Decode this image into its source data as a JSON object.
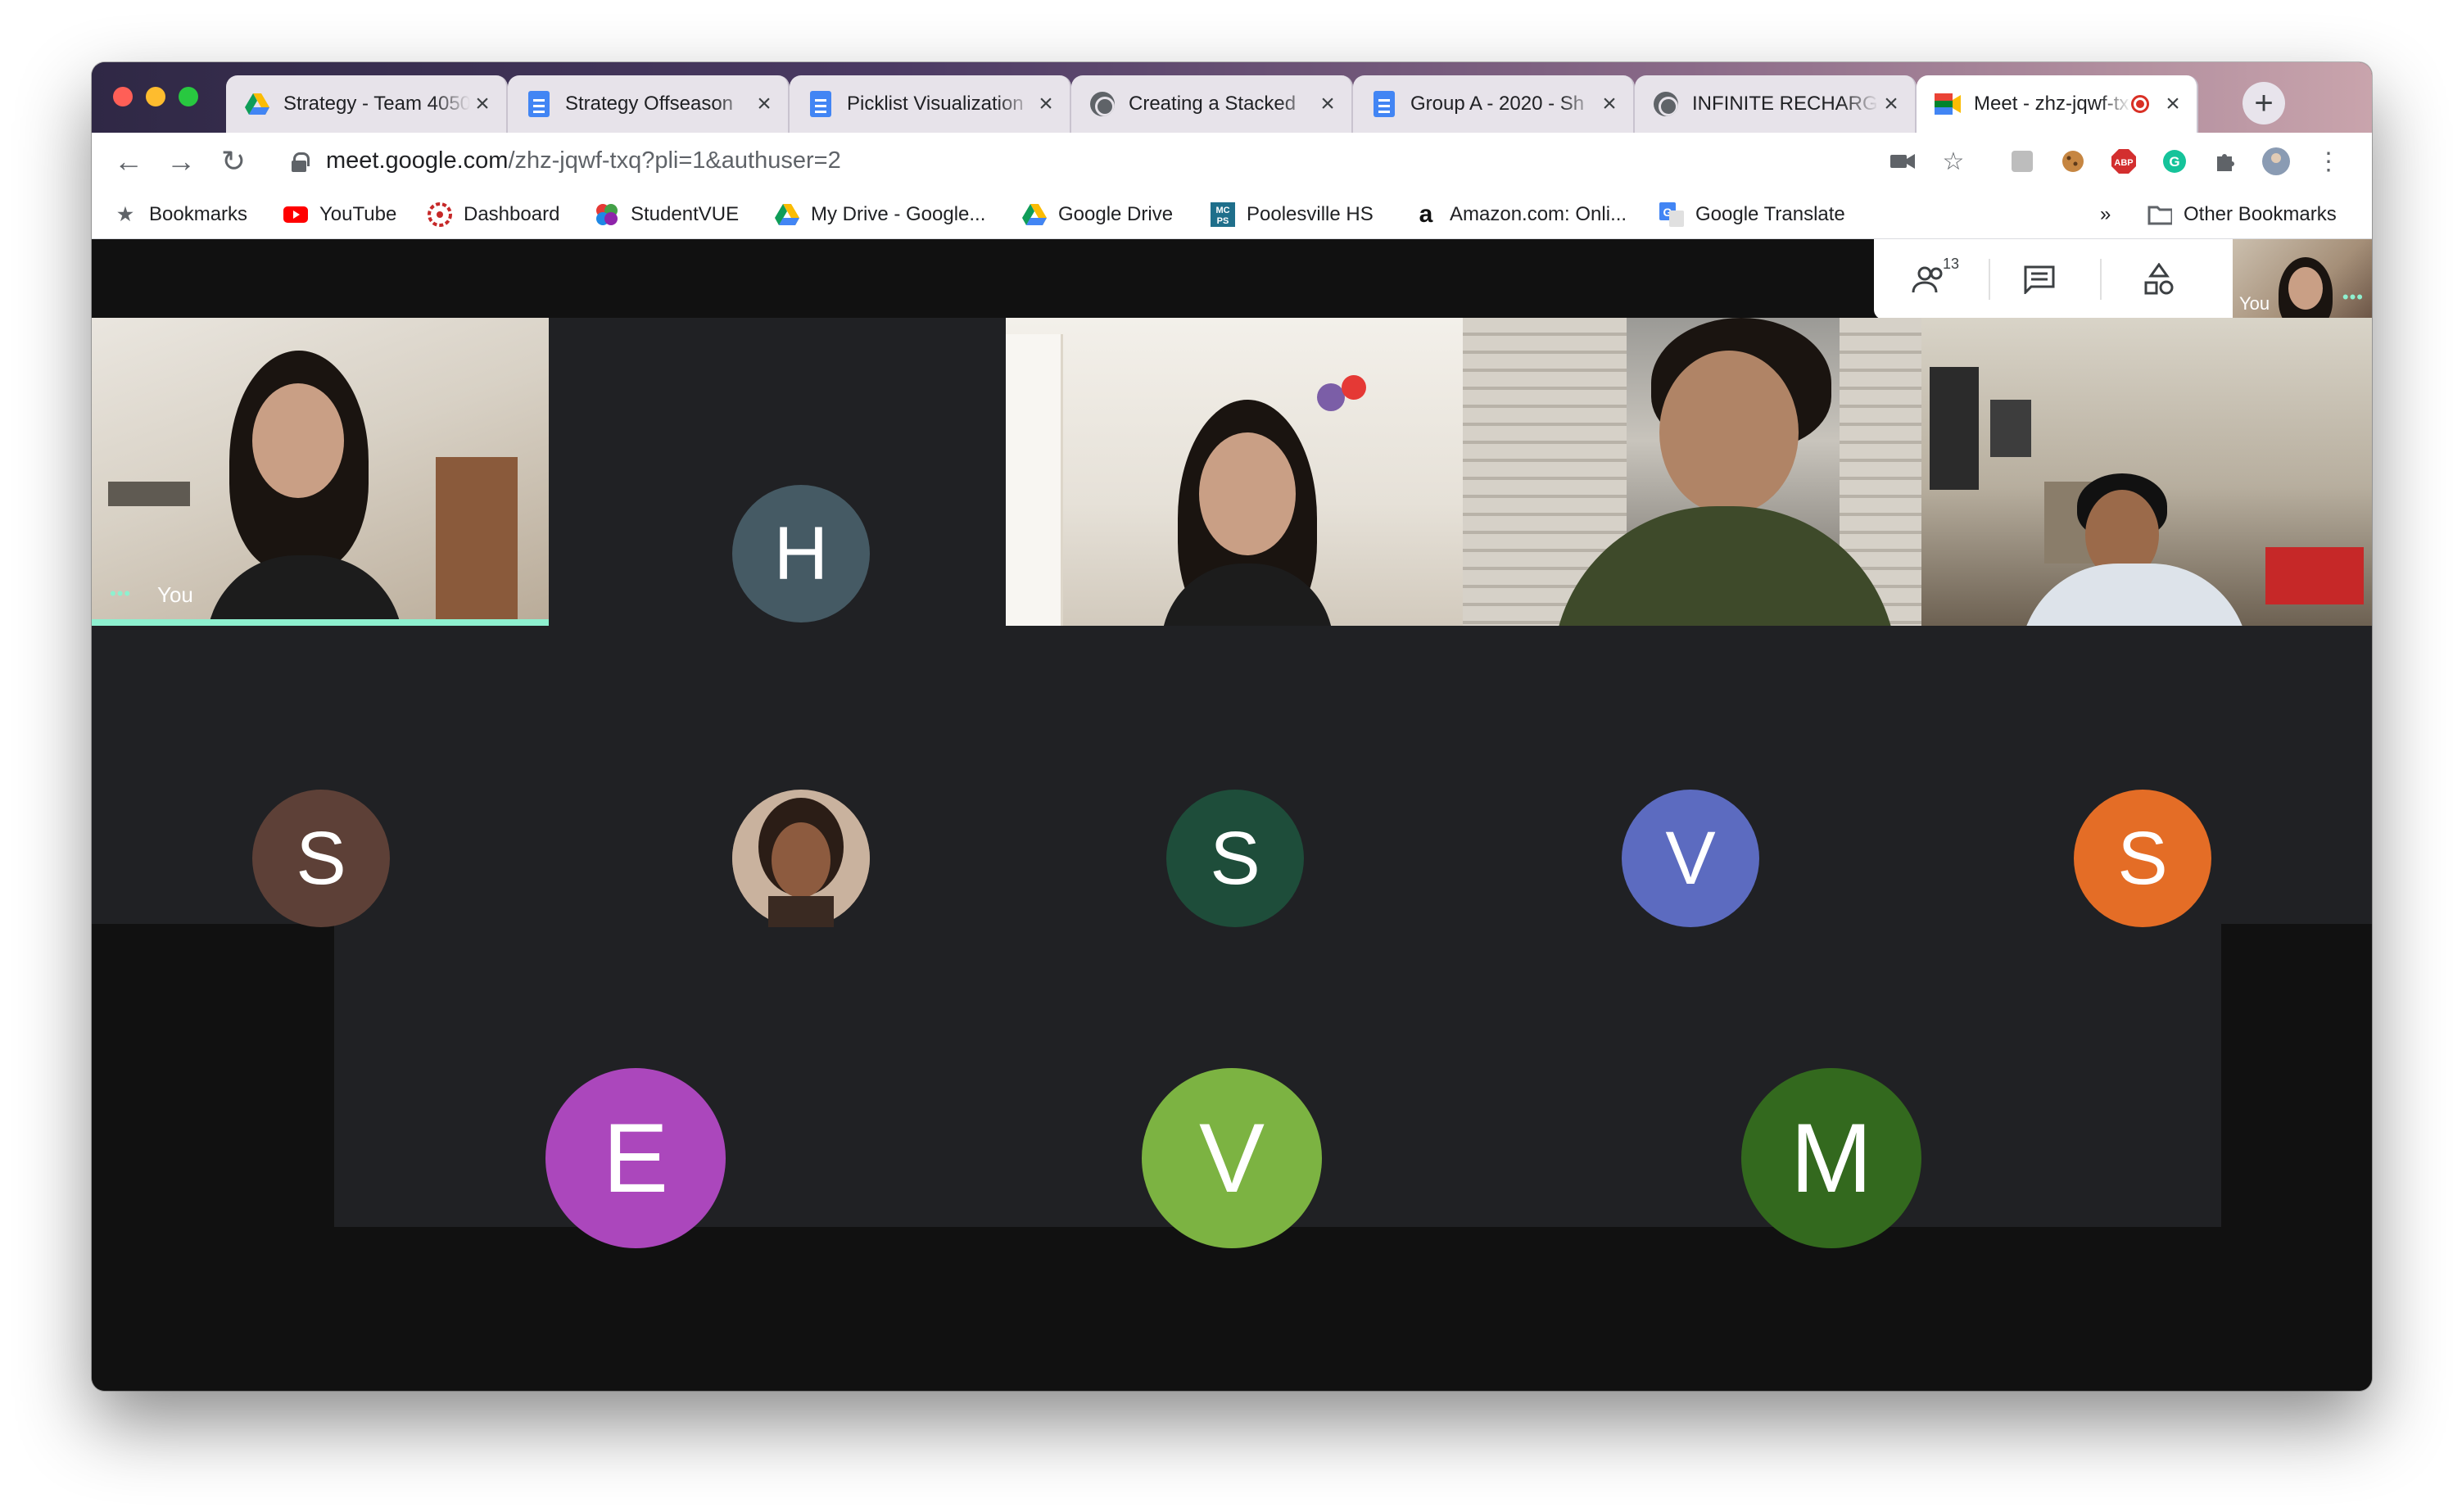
{
  "tabs": [
    {
      "title": "Strategy - Team 4050",
      "icon": "google-drive-icon",
      "active": false
    },
    {
      "title": "Strategy Offseason",
      "icon": "google-docs-icon",
      "active": false
    },
    {
      "title": "Picklist Visualization",
      "icon": "google-docs-icon",
      "active": false
    },
    {
      "title": "Creating a Stacked",
      "icon": "globe-icon",
      "active": false
    },
    {
      "title": "Group A - 2020 - Sh",
      "icon": "google-docs-icon",
      "active": false
    },
    {
      "title": "INFINITE RECHARGE",
      "icon": "globe-icon",
      "active": false
    },
    {
      "title": "Meet - zhz-jqwf-txq",
      "icon": "google-meet-icon",
      "active": true,
      "recording": true
    }
  ],
  "address_bar": {
    "domain": "meet.google.com",
    "path": "/zhz-jqwf-txq?pli=1&authuser=2"
  },
  "bookmarks": [
    {
      "label": "Bookmarks",
      "icon": "star-icon"
    },
    {
      "label": "YouTube",
      "icon": "youtube-icon"
    },
    {
      "label": "Dashboard",
      "icon": "dashboard-icon"
    },
    {
      "label": "StudentVUE",
      "icon": "studentvue-icon"
    },
    {
      "label": "My Drive - Google...",
      "icon": "google-drive-icon"
    },
    {
      "label": "Google Drive",
      "icon": "google-drive-icon"
    },
    {
      "label": "Poolesville HS",
      "icon": "mcps-icon"
    },
    {
      "label": "Amazon.com: Onli...",
      "icon": "amazon-icon"
    },
    {
      "label": "Google Translate",
      "icon": "google-translate-icon"
    }
  ],
  "bookmarks_overflow": "»",
  "other_bookmarks": "Other Bookmarks",
  "meet": {
    "participant_count": "13",
    "self_label": "You",
    "avatars_row2": [
      {
        "initial": "S",
        "color": "#5d4037"
      },
      {
        "initial": "",
        "color": "#8d6e63",
        "photo": true
      },
      {
        "initial": "S",
        "color": "#1e4d3a"
      },
      {
        "initial": "V",
        "color": "#5c6bc0"
      },
      {
        "initial": "S",
        "color": "#e46d26"
      }
    ],
    "avatars_row3": [
      {
        "initial": "E",
        "color": "#ab47bc"
      },
      {
        "initial": "V",
        "color": "#7cb342"
      },
      {
        "initial": "M",
        "color": "#33691e"
      }
    ],
    "avatar_h": {
      "initial": "H",
      "color": "#455a64"
    }
  }
}
